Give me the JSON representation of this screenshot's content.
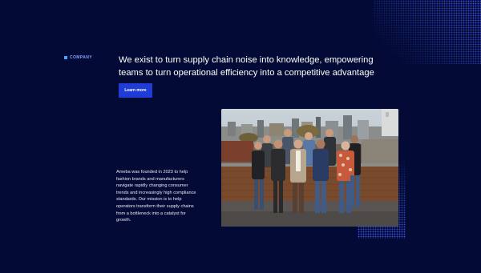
{
  "section": {
    "eyebrow": "COMPANY",
    "headline": "We exist to turn supply chain noise into knowledge, empowering teams to turn operational efficiency into a competitive advantage",
    "cta_label": "Learn more",
    "description": "Ameba was founded in 2023 to help fashion brands and manufacturers navigate rapidly changing consumer trends and increasingly high compliance standards. Our mission is to help operators transform their supply chains from a bottleneck into a catalyst for growth."
  },
  "colors": {
    "background": "#030a35",
    "accent": "#1f3cd6",
    "eyebrow_marker": "#4ea1ff"
  },
  "icons": {
    "eyebrow_marker": "square-bullet-icon"
  }
}
